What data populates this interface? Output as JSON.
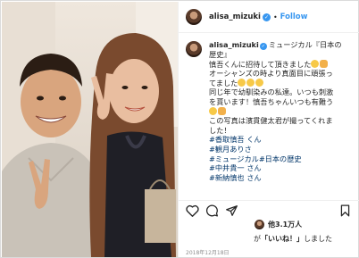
{
  "header": {
    "username": "alisa_mizuki",
    "verified_glyph": "✓",
    "separator": "•",
    "follow_label": "Follow"
  },
  "caption": {
    "username": "alisa_mizuki",
    "lines": [
      "ミュージカル『日本の",
      "歴史』",
      "慎吾くんに招待して頂きました",
      "オーシャンズの時より真面目に頑張っ",
      "てました",
      "同じ年で幼馴染みの私達。いつも刺激",
      "を貰います！慎吾ちゃんいつも有難う",
      "",
      "この写真は濱貫健太君が撮ってくれま",
      "した！"
    ],
    "tags": [
      "#香取慎吾 くん",
      "#観月ありさ",
      "#ミュージカル#日本の歴史",
      "#中井貴一 さん",
      "#新納慎也 さん"
    ]
  },
  "actions": {
    "icons": [
      "heart-icon",
      "comment-icon",
      "share-icon",
      "bookmark-icon"
    ],
    "likes_count": "他3.1万人",
    "likes_text_prefix": "が",
    "likes_text_quote": "「いいね！」",
    "likes_text_suffix": "しました",
    "date": "2018年12月18日"
  },
  "colors": {
    "accent": "#3897f0",
    "text": "#262626",
    "hashtag": "#003569",
    "muted": "#8e8e8e",
    "border": "#dbdbdb"
  }
}
